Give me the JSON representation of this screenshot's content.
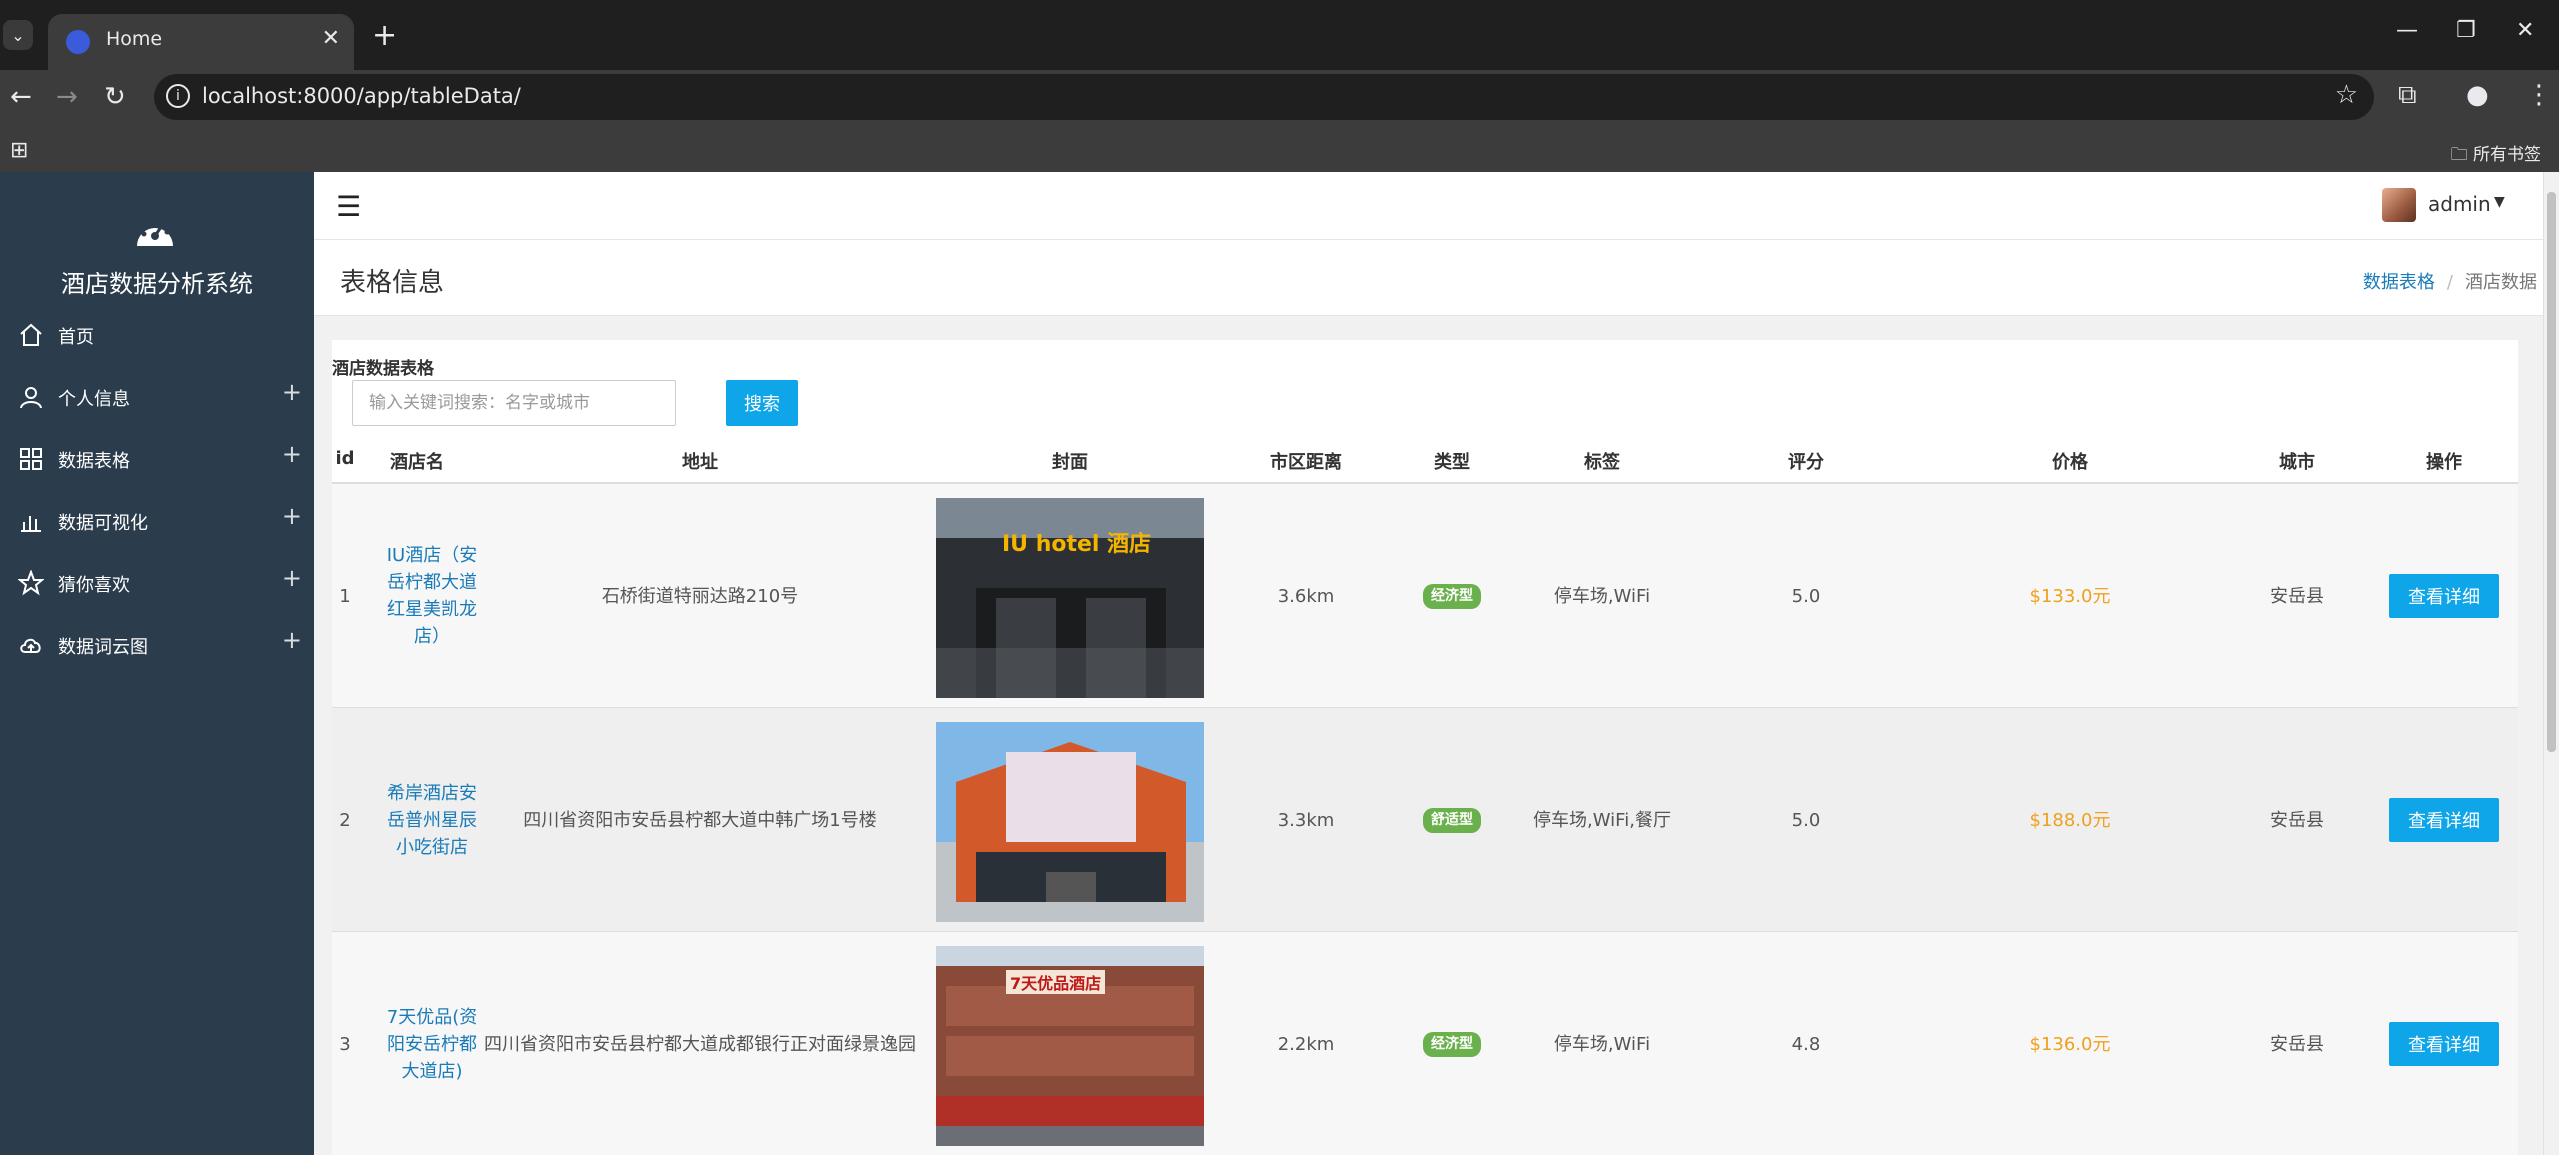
{
  "browser": {
    "tab_title": "Home",
    "url": "localhost:8000/app/tableData/",
    "bookmarks_all": "所有书签"
  },
  "sidebar": {
    "brand": "酒店数据分析系统",
    "items": [
      {
        "label": "首页",
        "icon": "home-icon",
        "expandable": false
      },
      {
        "label": "个人信息",
        "icon": "user-icon",
        "expandable": true
      },
      {
        "label": "数据表格",
        "icon": "grid-icon",
        "expandable": true
      },
      {
        "label": "数据可视化",
        "icon": "bar-chart-icon",
        "expandable": true
      },
      {
        "label": "猜你喜欢",
        "icon": "star-icon",
        "expandable": true
      },
      {
        "label": "数据词云图",
        "icon": "cloud-icon",
        "expandable": true
      }
    ],
    "plus_label": "+"
  },
  "topbar": {
    "user_name": "admin"
  },
  "header": {
    "title": "表格信息",
    "breadcrumb_link": "数据表格",
    "breadcrumb_sep": "/",
    "breadcrumb_current": "酒店数据"
  },
  "card": {
    "title": "酒店数据表格",
    "search_placeholder": "输入关键词搜索：名字或城市",
    "search_button": "搜索"
  },
  "table": {
    "headers": [
      "id",
      "酒店名",
      "地址",
      "封面",
      "市区距离",
      "类型",
      "标签",
      "评分",
      "价格",
      "城市",
      "操作"
    ],
    "rows": [
      {
        "id": "1",
        "name": "IU酒店（安岳柠都大道红星美凯龙店）",
        "address": "石桥街道特丽达路210号",
        "cover_sign": "IU hotel 酒店",
        "distance": "3.6km",
        "type": "经济型",
        "tags": "停车场,WiFi",
        "score": "5.0",
        "price": "$133.0元",
        "city": "安岳县",
        "action": "查看详细"
      },
      {
        "id": "2",
        "name": "希岸酒店安岳普州星辰小吃街店",
        "address": "四川省资阳市安岳县柠都大道中韩广场1号楼",
        "cover_sign": "",
        "distance": "3.3km",
        "type": "舒适型",
        "tags": "停车场,WiFi,餐厅",
        "score": "5.0",
        "price": "$188.0元",
        "city": "安岳县",
        "action": "查看详细"
      },
      {
        "id": "3",
        "name": "7天优品(资阳安岳柠都大道店)",
        "address": "四川省资阳市安岳县柠都大道成都银行正对面绿景逸园",
        "cover_sign": "7天优品酒店",
        "distance": "2.2km",
        "type": "经济型",
        "tags": "停车场,WiFi",
        "score": "4.8",
        "price": "$136.0元",
        "city": "安岳县",
        "action": "查看详细"
      }
    ]
  },
  "colors": {
    "sidebar_bg": "#2b3c4c",
    "accent": "#0ea5e9",
    "link": "#1a7bb9",
    "price": "#f0a020",
    "badge": "#6ab04c"
  }
}
